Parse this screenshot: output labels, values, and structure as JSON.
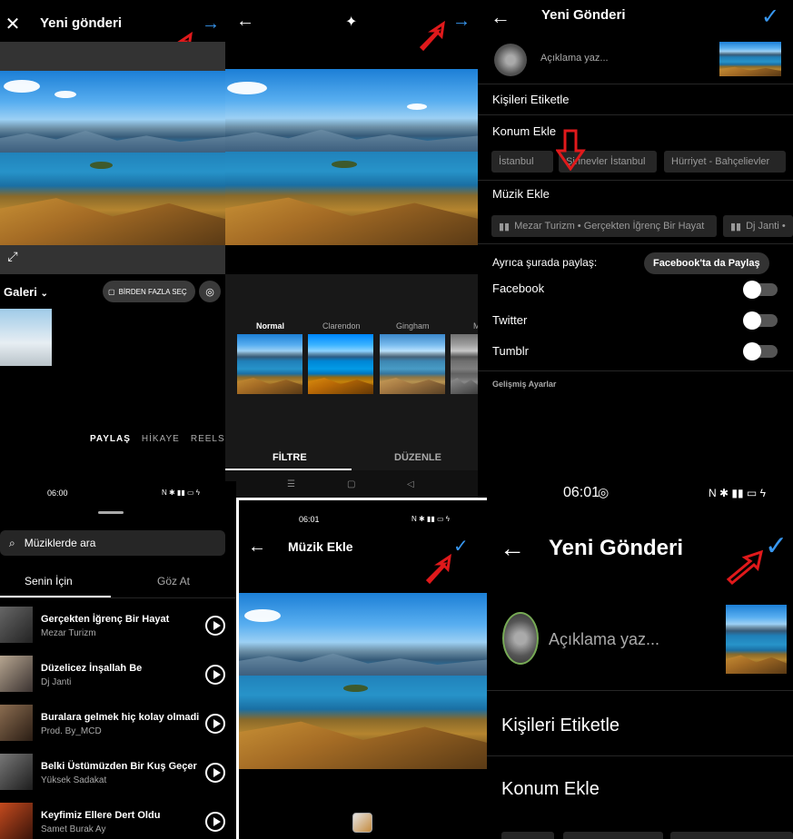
{
  "panel1": {
    "title": "Yeni gönderi",
    "gallery_label": "Galeri",
    "multi_select": "BİRDEN FAZLA SEÇ",
    "tabs": [
      "PAYLAŞ",
      "HİKAYE",
      "REELS"
    ]
  },
  "panel2": {
    "filters": [
      "Normal",
      "Clarendon",
      "Gingham",
      "M"
    ],
    "bottom_tabs": [
      "FİLTRE",
      "DÜZENLE"
    ]
  },
  "panel3": {
    "title": "Yeni Gönderi",
    "caption_placeholder": "Açıklama yaz...",
    "tag_people": "Kişileri Etiketle",
    "add_location": "Konum Ekle",
    "location_chips": [
      "İstanbul",
      "Şirinevler İstanbul",
      "Hürriyet - Bahçelievler"
    ],
    "add_music": "Müzik Ekle",
    "music_chips": [
      "Mezar Turizm • Gerçekten İğrenç Bir Hayat",
      "Dj Janti •"
    ],
    "share_also": "Ayrıca şurada paylaş:",
    "tooltip": "Facebook'ta da Paylaş",
    "networks": [
      "Facebook",
      "Twitter",
      "Tumblr"
    ],
    "advanced": "Gelişmiş Ayarlar"
  },
  "panel4": {
    "time": "06:00",
    "search_placeholder": "Müziklerde ara",
    "tabs": [
      "Senin İçin",
      "Göz At"
    ],
    "songs": [
      {
        "title": "Gerçekten İğrenç Bir Hayat",
        "artist": "Mezar Turizm"
      },
      {
        "title": "Düzelicez İnşallah Be",
        "artist": "Dj Janti"
      },
      {
        "title": "Buralara gelmek hiç kolay olmadi",
        "artist": "Prod. By_MCD"
      },
      {
        "title": "Belki Üstümüzden Bir Kuş Geçer",
        "artist": "Yüksek Sadakat"
      },
      {
        "title": "Keyfimiz Ellere Dert Oldu",
        "artist": "Samet Burak Ay"
      }
    ]
  },
  "panel5": {
    "time": "06:01",
    "title": "Müzik Ekle"
  },
  "panel6": {
    "time": "06:01",
    "title": "Yeni Gönderi",
    "caption_placeholder": "Açıklama yaz...",
    "tag_people": "Kişileri Etiketle",
    "add_location": "Konum Ekle"
  },
  "colors": {
    "accent": "#3897f0",
    "red_arrow": "#e0191b"
  }
}
